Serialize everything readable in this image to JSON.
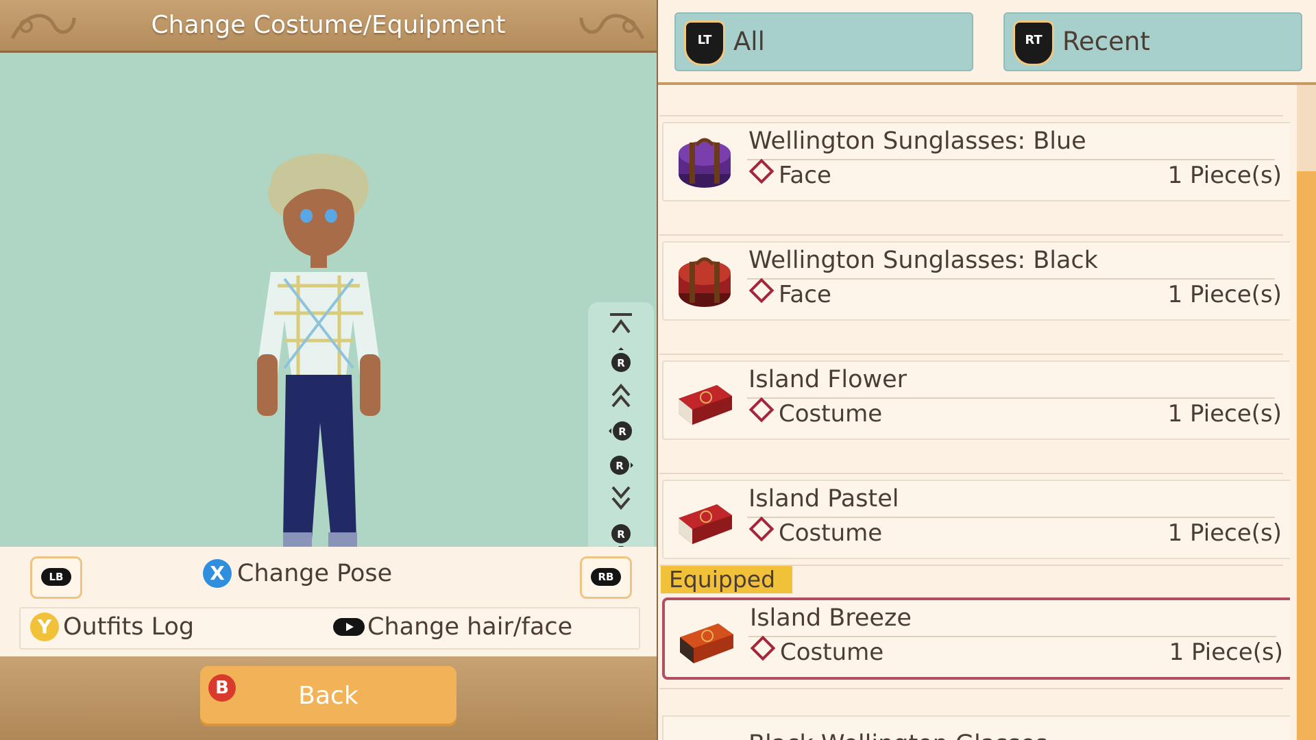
{
  "header": {
    "title": "Change Costume/Equipment"
  },
  "preview": {
    "camera_controls": [
      "top-icon",
      "r-up-icon",
      "zoom-in-icon",
      "r-left-icon",
      "r-right-icon",
      "zoom-out-icon",
      "r-down-icon",
      "bottom-icon"
    ]
  },
  "controls": {
    "lb_label": "LB",
    "rb_label": "RB",
    "pose_button": "X",
    "pose_label": "Change Pose",
    "outfits_button": "Y",
    "outfits_label": "Outfits Log",
    "hairface_label": "Change hair/face"
  },
  "footer": {
    "back_button": "B",
    "back_label": "Back"
  },
  "tabs": [
    {
      "badge": "LT",
      "label": "All"
    },
    {
      "badge": "RT",
      "label": "Recent"
    }
  ],
  "items": [
    {
      "name": "Wellington Sunglasses: Blue",
      "type": "Face",
      "count": "1 Piece(s)",
      "icon": "purple-case-icon",
      "color": "#5b2a86",
      "equipped": false
    },
    {
      "name": "Wellington Sunglasses: Black",
      "type": "Face",
      "count": "1 Piece(s)",
      "icon": "red-case-icon",
      "color": "#9a1f1f",
      "equipped": false
    },
    {
      "name": "Island Flower",
      "type": "Costume",
      "count": "1 Piece(s)",
      "icon": "red-suitcase-icon",
      "color": "#a81e22",
      "equipped": false
    },
    {
      "name": "Island Pastel",
      "type": "Costume",
      "count": "1 Piece(s)",
      "icon": "red-suitcase-icon",
      "color": "#a81e22",
      "equipped": false
    },
    {
      "name": "Island Breeze",
      "type": "Costume",
      "count": "1 Piece(s)",
      "icon": "orange-suitcase-icon",
      "color": "#c9401c",
      "equipped": true
    }
  ],
  "equipped_label": "Equipped",
  "partial_item": {
    "name": "Black Wellington Glasses"
  },
  "colors": {
    "accent": "#f2b358",
    "tab": "#a7d0cd",
    "equipped_border": "#b24e64",
    "preview_bg": "#afd6c5"
  }
}
